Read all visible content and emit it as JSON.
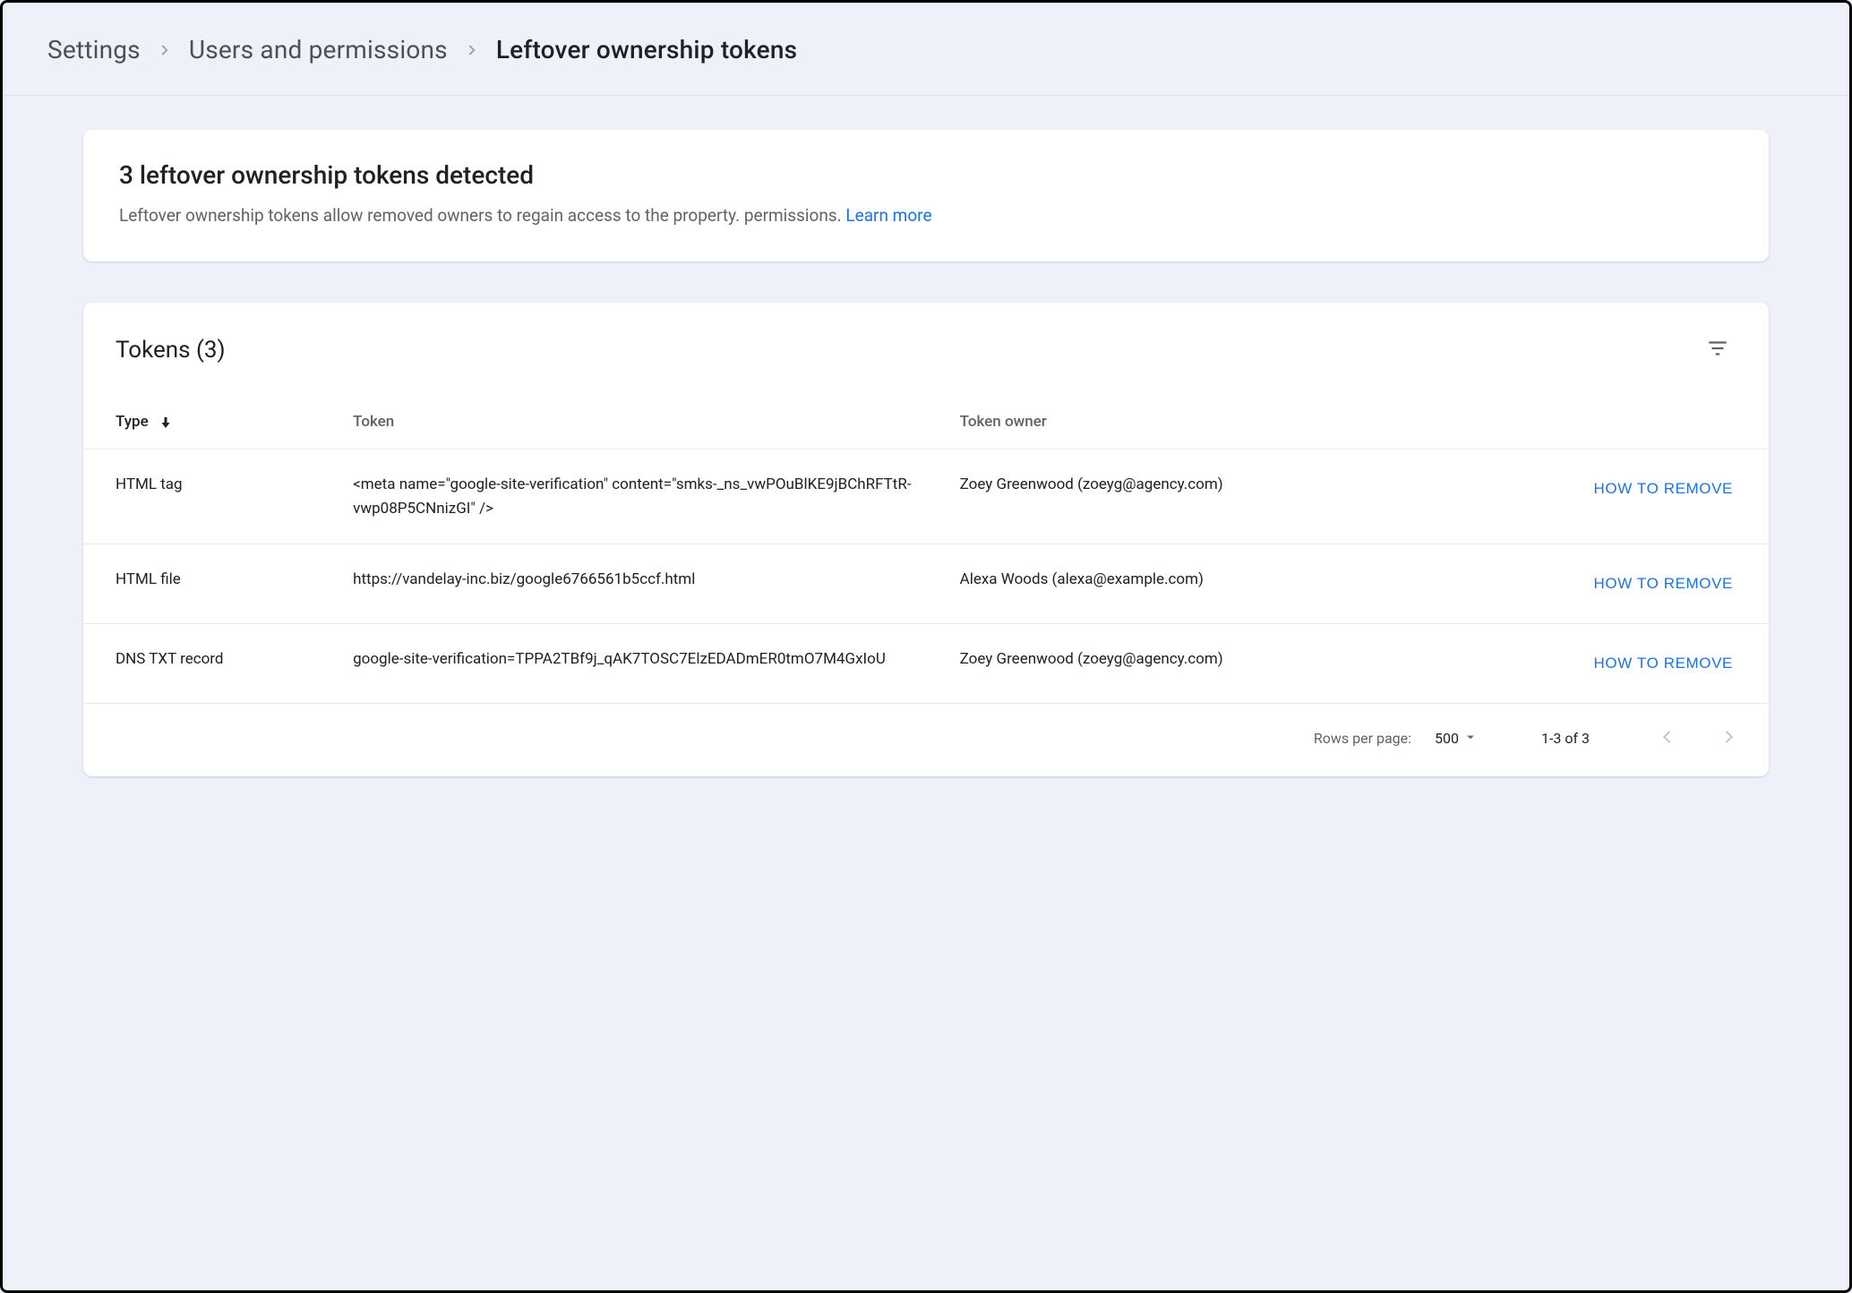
{
  "breadcrumbs": {
    "items": [
      {
        "label": "Settings"
      },
      {
        "label": "Users and permissions"
      },
      {
        "label": "Leftover ownership tokens"
      }
    ]
  },
  "alert": {
    "title": "3 leftover ownership tokens detected",
    "body": "Leftover ownership tokens allow removed owners to regain access to the property. permissions. ",
    "learn_more": "Learn more"
  },
  "table": {
    "title": "Tokens (3)",
    "columns": {
      "type": "Type",
      "token": "Token",
      "owner": "Token owner"
    },
    "action_label": "HOW TO REMOVE",
    "rows": [
      {
        "type": "HTML tag",
        "token": "<meta name=\"google-site-verification\" content=\"smks-_ns_vwPOuBlKE9jBChRFTtR-vwp08P5CNnizGI\" />",
        "owner": "Zoey Greenwood (zoeyg@agency.com)"
      },
      {
        "type": "HTML file",
        "token": "https://vandelay-inc.biz/google6766561b5ccf.html",
        "owner": "Alexa Woods (alexa@example.com)"
      },
      {
        "type": "DNS TXT record",
        "token": "google-site-verification=TPPA2TBf9j_qAK7TOSC7ElzEDADmER0tmO7M4GxIoU",
        "owner": "Zoey Greenwood (zoeyg@agency.com)"
      }
    ]
  },
  "pager": {
    "rows_per_page_label": "Rows per page:",
    "rows_per_page_value": "500",
    "range": "1-3 of 3"
  }
}
